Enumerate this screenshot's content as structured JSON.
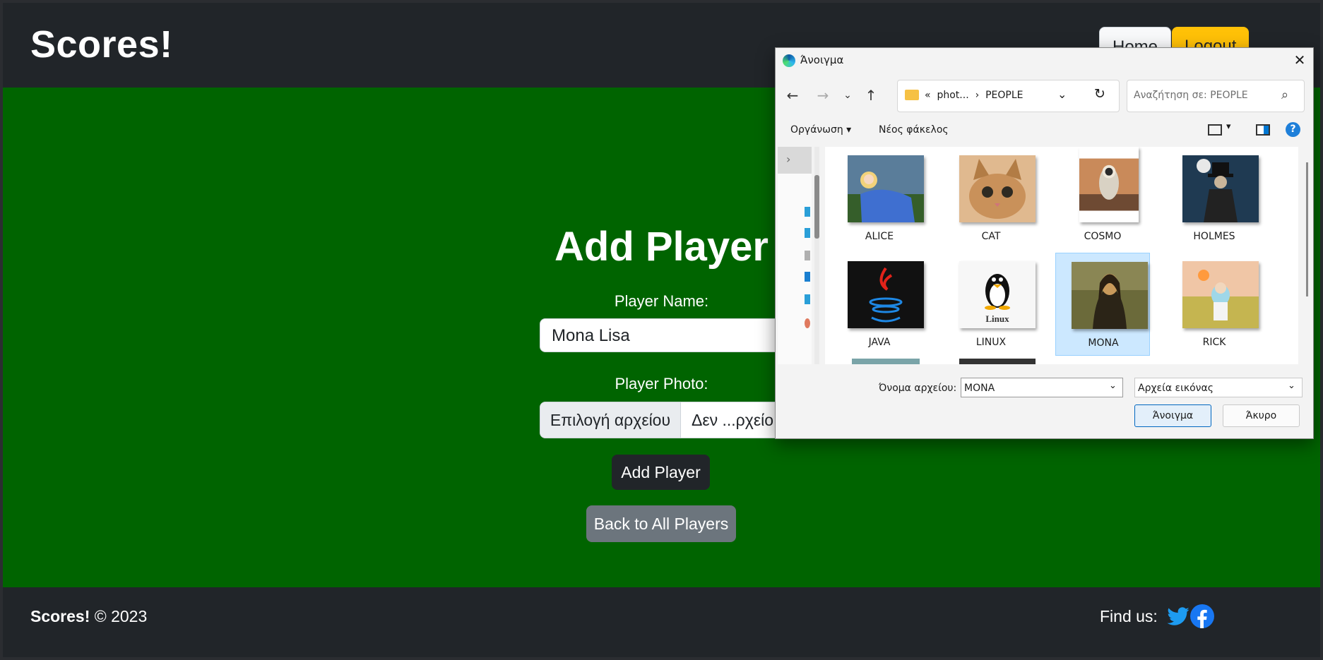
{
  "header": {
    "brand": "Scores!",
    "home_label": "Home",
    "logout_label": "Logout"
  },
  "main": {
    "title": "Add Player",
    "name_label": "Player Name:",
    "name_value": "Mona Lisa",
    "photo_label": "Player Photo:",
    "file_button": "Επιλογή αρχείου",
    "file_status": "Δεν ...ρχείο",
    "add_button": "Add Player",
    "back_button": "Back to All Players"
  },
  "footer": {
    "brand": "Scores!",
    "copyright": "© 2023",
    "find_us": "Find us:",
    "icons": [
      "twitter-icon",
      "facebook-icon"
    ]
  },
  "dialog": {
    "title": "Άνοιγμα",
    "path_prefix": "«",
    "path_folder": "phot...",
    "path_sep": "›",
    "path_current": "PEOPLE",
    "search_placeholder": "Αναζήτηση σε: PEOPLE",
    "organize": "Οργάνωση ▾",
    "new_folder": "Νέος φάκελος",
    "files": [
      {
        "label": "ALICE"
      },
      {
        "label": "CAT"
      },
      {
        "label": "COSMO"
      },
      {
        "label": "HOLMES"
      },
      {
        "label": "JAVA"
      },
      {
        "label": "LINUX"
      },
      {
        "label": "MONA"
      },
      {
        "label": "RICK"
      }
    ],
    "selected_file": "MONA",
    "linux_thumb_text": "Linux",
    "filename_label": "Όνομα αρχείου:",
    "filename_value": "MONA",
    "filetype_value": "Αρχεία εικόνας",
    "open_button": "Άνοιγμα",
    "cancel_button": "Άκυρο"
  },
  "colors": {
    "main_bg": "#006400",
    "dark": "#212529",
    "logout": "#ffc107",
    "secondary": "#6c757d",
    "twitter": "#1d9bf0",
    "facebook": "#1877f2"
  }
}
